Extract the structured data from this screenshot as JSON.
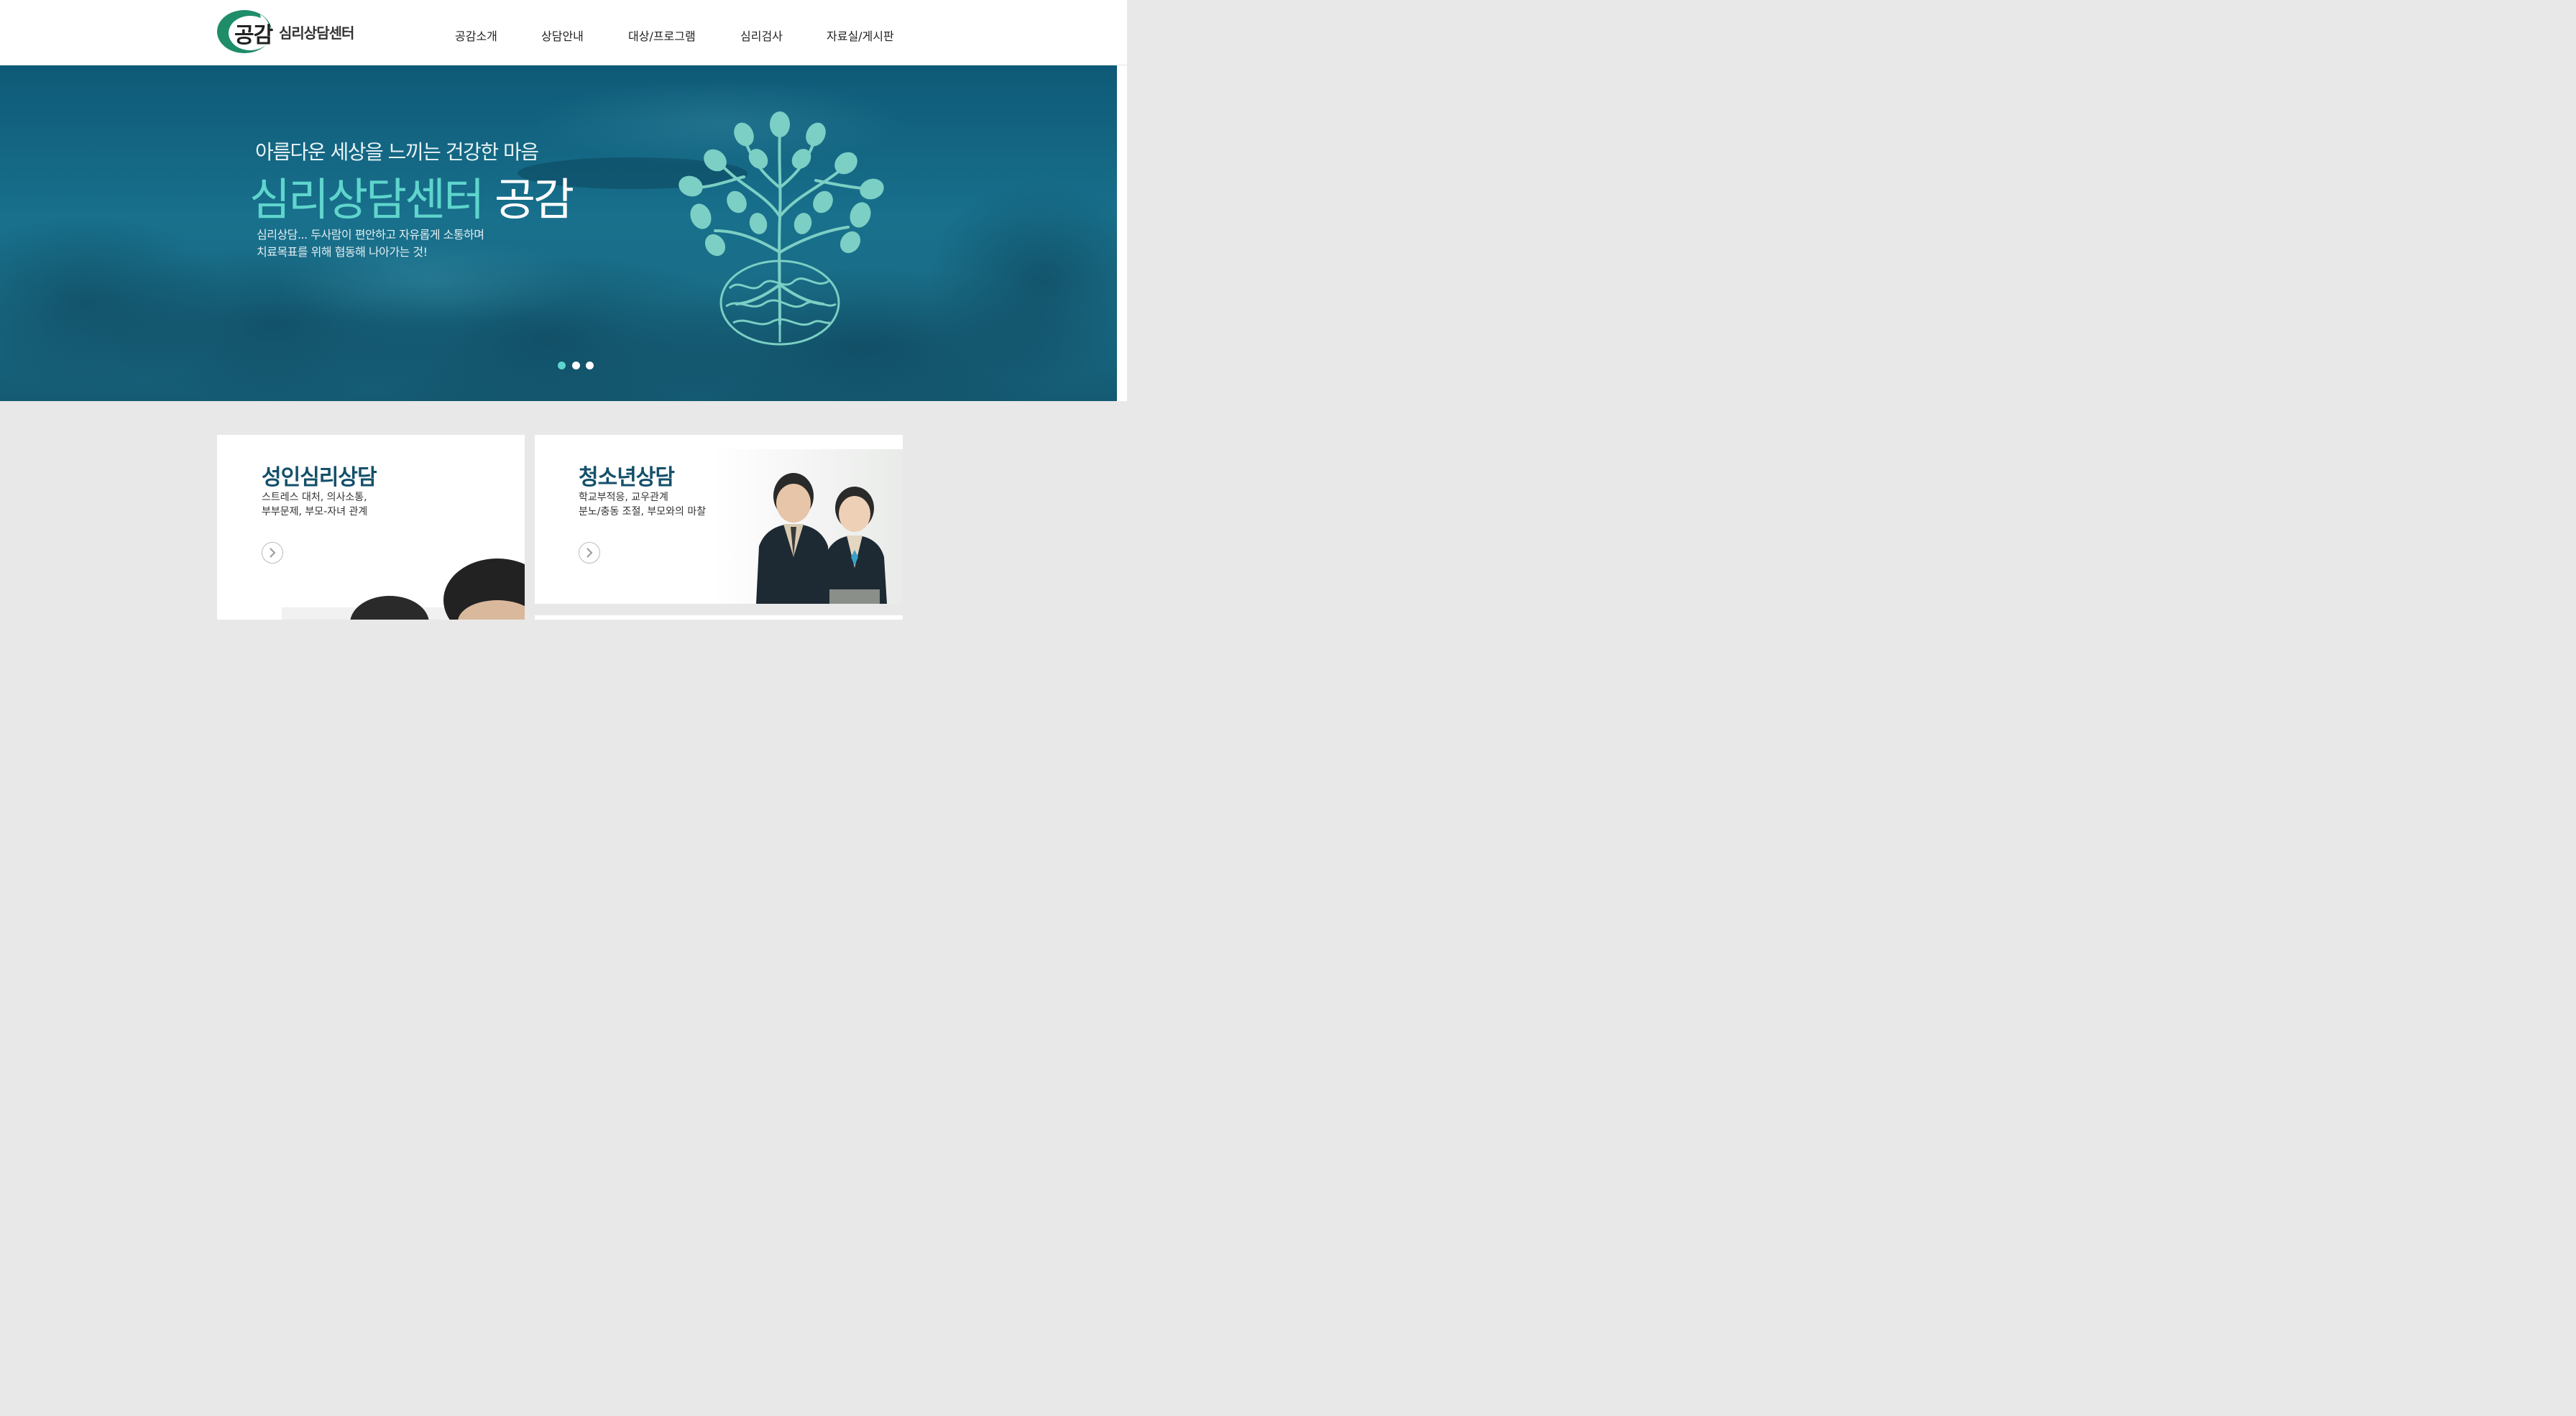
{
  "header": {
    "logo_main": "공감",
    "logo_sub": "심리상담센터",
    "nav": [
      {
        "label": "공감소개"
      },
      {
        "label": "상담안내"
      },
      {
        "label": "대상/프로그램"
      },
      {
        "label": "심리검사"
      },
      {
        "label": "자료실/게시판"
      }
    ]
  },
  "hero": {
    "subtitle": "아름다운 세상을 느끼는 건강한 마음",
    "title_accent": "심리상담센터",
    "title_plain": "공감",
    "desc_line1": "심리상담... 두사람이 편안하고 자유롭게 소통하며",
    "desc_line2": "치료목표를 위해 협동해 나아가는 것!",
    "slide_count": 3,
    "active_slide": 1,
    "accent_color": "#5fd5cd",
    "background_color": "#18708c"
  },
  "cards": [
    {
      "title": "성인심리상담",
      "desc_line1": "스트레스 대처, 의사소통,",
      "desc_line2": "부부문제, 부모-자녀 관계",
      "more_icon": "chevron-right-icon"
    },
    {
      "title": "청소년상담",
      "desc_line1": "학교부적응, 교우관계",
      "desc_line2": "분노/충동 조절, 부모와의 마찰",
      "more_icon": "chevron-right-icon"
    }
  ],
  "colors": {
    "brand_green": "#1f8c6a",
    "card_title": "#14506a",
    "page_bg": "#e8e8e8"
  }
}
